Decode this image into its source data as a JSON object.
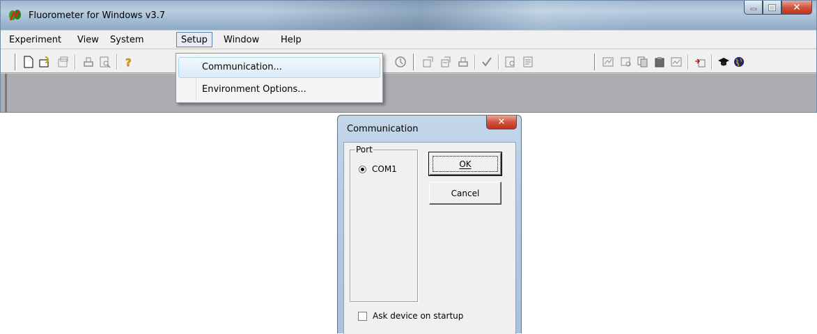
{
  "window": {
    "title": "Fluorometer for Windows v3.7",
    "accent_color": "#a7bfd6"
  },
  "menu_bar": {
    "items": [
      {
        "label": "Experiment"
      },
      {
        "label": "View"
      },
      {
        "label": "System"
      },
      {
        "label": "Setup",
        "active": true
      },
      {
        "label": "Window"
      },
      {
        "label": "Help"
      }
    ]
  },
  "setup_menu": {
    "items": [
      {
        "label": "Communication...",
        "highlighted": true
      },
      {
        "label": "Environment Options..."
      }
    ]
  },
  "toolbar": {
    "icons": [
      "new-file-icon",
      "open-icon",
      "open-disabled-icon",
      "print-icon",
      "print-preview-icon",
      "help-icon",
      "timer-icon",
      "export-icon",
      "import-icon",
      "printer-icon",
      "check-icon",
      "find-icon",
      "report-icon",
      "graph-icon",
      "graph-zoom-icon",
      "copy-icon",
      "paste-icon",
      "chart-icon",
      "transfer-icon",
      "graduation-cap-icon",
      "globe-icon"
    ]
  },
  "dialog": {
    "title": "Communication",
    "port_group_label": "Port",
    "port_option": "COM1",
    "port_selected": true,
    "ok_label": "OK",
    "cancel_label": "Cancel",
    "ask_device_label": "Ask device on startup",
    "ask_device_checked": false
  }
}
